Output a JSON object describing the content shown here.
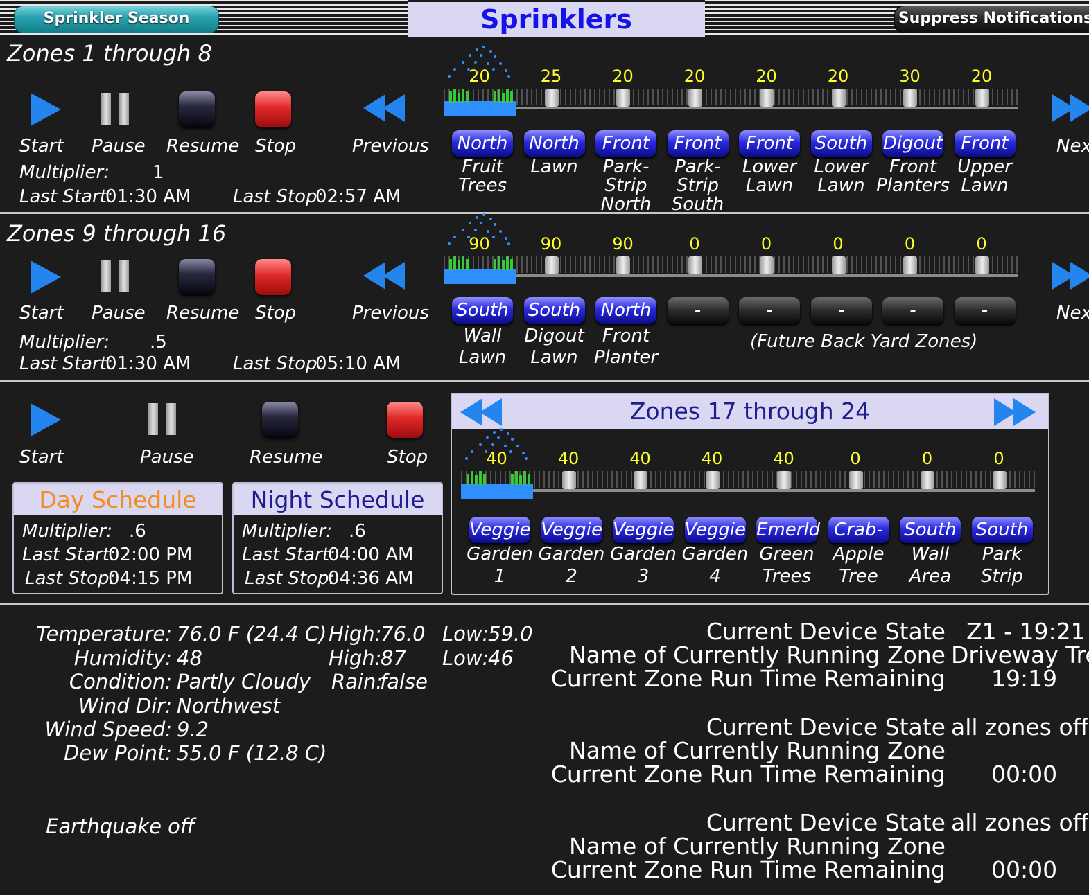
{
  "header": {
    "season_button": "Sprinkler Season",
    "title": "Sprinklers",
    "suppress_button": "Suppress Notifications"
  },
  "controls": {
    "start": "Start",
    "pause": "Pause",
    "resume": "Resume",
    "stop": "Stop",
    "previous": "Previous",
    "next": "Nex"
  },
  "labels": {
    "multiplier": "Multiplier:",
    "last_start": "Last Start:",
    "last_stop": "Last Stop:"
  },
  "group1": {
    "title": "Zones 1 through 8",
    "multiplier": "1",
    "last_start": "01:30 AM",
    "last_stop": "02:57 AM",
    "zones": [
      {
        "value": "20",
        "button": "North",
        "name": [
          "Fruit",
          "Trees"
        ]
      },
      {
        "value": "25",
        "button": "North",
        "name": [
          "Lawn"
        ]
      },
      {
        "value": "20",
        "button": "Front",
        "name": [
          "Park-",
          "Strip",
          "North"
        ]
      },
      {
        "value": "20",
        "button": "Front",
        "name": [
          "Park-",
          "Strip",
          "South"
        ]
      },
      {
        "value": "20",
        "button": "Front",
        "name": [
          "Lower",
          "Lawn"
        ]
      },
      {
        "value": "20",
        "button": "South",
        "name": [
          "Lower",
          "Lawn"
        ]
      },
      {
        "value": "30",
        "button": "Digout",
        "name": [
          "Front",
          "Planters"
        ]
      },
      {
        "value": "20",
        "button": "Front",
        "name": [
          "Upper",
          "Lawn"
        ]
      }
    ]
  },
  "group2": {
    "title": "Zones 9 through 16",
    "multiplier": ".5",
    "last_start": "01:30 AM",
    "last_stop": "05:10 AM",
    "future_note": "(Future Back Yard Zones)",
    "zones": [
      {
        "value": "90",
        "button": "South",
        "name": [
          "Wall",
          "Lawn"
        ]
      },
      {
        "value": "90",
        "button": "South",
        "name": [
          "Digout",
          "Lawn"
        ]
      },
      {
        "value": "90",
        "button": "North",
        "name": [
          "Front",
          "Planter"
        ]
      },
      {
        "value": "0",
        "button": "-",
        "name": []
      },
      {
        "value": "0",
        "button": "-",
        "name": []
      },
      {
        "value": "0",
        "button": "-",
        "name": []
      },
      {
        "value": "0",
        "button": "-",
        "name": []
      },
      {
        "value": "0",
        "button": "-",
        "name": []
      }
    ]
  },
  "group3": {
    "title": "Zones 17 through 24",
    "zones": [
      {
        "value": "40",
        "button": "Veggie",
        "name": [
          "Garden",
          "1"
        ]
      },
      {
        "value": "40",
        "button": "Veggie",
        "name": [
          "Garden",
          "2"
        ]
      },
      {
        "value": "40",
        "button": "Veggie",
        "name": [
          "Garden",
          "3"
        ]
      },
      {
        "value": "40",
        "button": "Veggie",
        "name": [
          "Garden",
          "4"
        ]
      },
      {
        "value": "40",
        "button": "Emerld",
        "name": [
          "Green",
          "Trees"
        ]
      },
      {
        "value": "0",
        "button": "Crab-",
        "name": [
          "Apple",
          "Tree"
        ]
      },
      {
        "value": "0",
        "button": "South",
        "name": [
          "Wall",
          "Area"
        ]
      },
      {
        "value": "0",
        "button": "South",
        "name": [
          "Park",
          "Strip"
        ]
      }
    ]
  },
  "day_schedule": {
    "title": "Day Schedule",
    "multiplier": ".6",
    "last_start": "02:00 PM",
    "last_stop": "04:15 PM"
  },
  "night_schedule": {
    "title": "Night Schedule",
    "multiplier": ".6",
    "last_start": "04:00 AM",
    "last_stop": "04:36 AM"
  },
  "weather": {
    "temperature_label": "Temperature:",
    "temperature": "76.0 F (24.4 C)",
    "temp_high_label": "High:",
    "temp_high": "76.0",
    "temp_low_label": "Low:",
    "temp_low": "59.0",
    "humidity_label": "Humidity:",
    "humidity": "48",
    "hum_high_label": "High:",
    "hum_high": "87",
    "hum_low_label": "Low:",
    "hum_low": "46",
    "condition_label": "Condition:",
    "condition": "Partly Cloudy",
    "rain_label": "Rain:",
    "rain": "false",
    "wind_dir_label": "Wind Dir:",
    "wind_dir": "Northwest",
    "wind_speed_label": "Wind Speed:",
    "wind_speed": "9.2",
    "dew_point_label": "Dew Point:",
    "dew_point": "55.0 F (12.8 C)"
  },
  "earthquake": "Earthquake off",
  "device_labels": {
    "state": "Current Device State",
    "zone_name": "Name of Currently Running Zone",
    "remaining": "Current Zone Run Time Remaining"
  },
  "devices": [
    {
      "state": "Z1 - 19:21",
      "zone_name": "Driveway Tre",
      "remaining": "19:19"
    },
    {
      "state": "all zones off",
      "zone_name": "",
      "remaining": "00:00"
    },
    {
      "state": "all zones off",
      "zone_name": "",
      "remaining": "00:00"
    }
  ],
  "colors": {
    "accent_blue": "#2585ef",
    "value_green": "#2ee82e",
    "value_yellow": "#ffff2a",
    "header_bg": "#dad7f3",
    "title_blue": "#1414e6",
    "day_orange": "#f28c1e",
    "night_navy": "#1e1e90"
  },
  "icons": [
    "play-icon",
    "pause-icon",
    "resume-icon",
    "stop-icon",
    "rewind-icon",
    "fast-forward-icon",
    "sprinkler-spray-icon"
  ]
}
